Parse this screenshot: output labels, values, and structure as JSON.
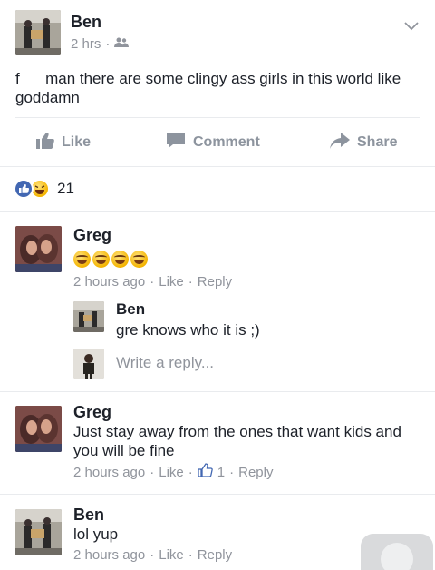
{
  "post": {
    "author": "Ben",
    "time": "2 hrs",
    "audience_icon": "friends-icon",
    "text_prefix": "f",
    "text": "man there are some clingy ass girls in this world like goddamn"
  },
  "actions": {
    "like": "Like",
    "comment": "Comment",
    "share": "Share"
  },
  "reactions": {
    "count": "21",
    "icons": [
      "like-reaction-icon",
      "haha-reaction-icon"
    ]
  },
  "comments": [
    {
      "author": "Greg",
      "emoji_count": 4,
      "time": "2 hours ago",
      "like": "Like",
      "reply": "Reply",
      "replies": [
        {
          "author": "Ben",
          "text": "gre knows who it is ;)"
        }
      ],
      "write_reply_placeholder": "Write a reply..."
    },
    {
      "author": "Greg",
      "text": "Just stay away from the ones that want kids and you will be fine",
      "time": "2 hours ago",
      "like": "Like",
      "like_count": "1",
      "reply": "Reply"
    },
    {
      "author": "Ben",
      "text": "lol yup",
      "time": "2 hours ago",
      "like": "Like",
      "reply": "Reply"
    }
  ],
  "colors": {
    "meta_gray": "#90949c",
    "action_gray": "#8d949e",
    "like_blue": "#4267b2",
    "divider": "#e9ebee"
  }
}
